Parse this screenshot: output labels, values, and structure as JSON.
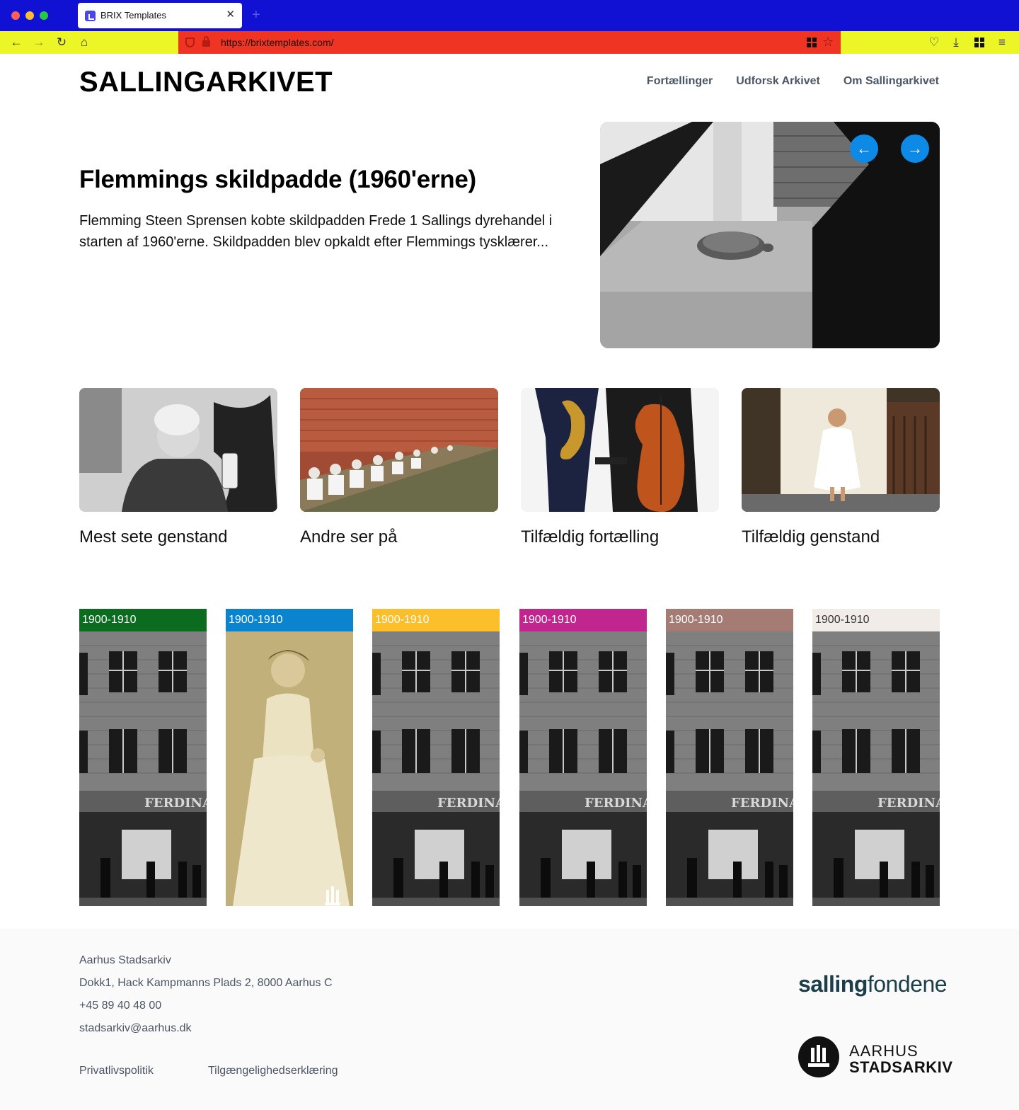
{
  "browser": {
    "tab_title": "BRIX Templates",
    "url": "https://brixtemplates.com/"
  },
  "site": {
    "logo": "SALLINGARKIVET",
    "nav": [
      "Fortællinger",
      "Udforsk Arkivet",
      "Om Sallingarkivet"
    ]
  },
  "hero": {
    "title": "Flemmings skildpadde (1960'erne)",
    "text": "Flemming Steen Sprensen kobte skildpadden Frede 1 Sallings dyrehandel i starten af 1960'erne. Skildpadden blev opkaldt efter Flemmings tysklærer..."
  },
  "cards": [
    {
      "title": "Mest sete genstand"
    },
    {
      "title": "Andre ser på"
    },
    {
      "title": "Tilfældig fortælling"
    },
    {
      "title": "Tilfældig genstand"
    }
  ],
  "decades": [
    {
      "label": "1900-1910",
      "color": "#0b6b1f",
      "text_color": "#ffffff"
    },
    {
      "label": "1900-1910",
      "color": "#0b84d0",
      "text_color": "#ffffff"
    },
    {
      "label": "1900-1910",
      "color": "#fbbf2c",
      "text_color": "#ffffff"
    },
    {
      "label": "1900-1910",
      "color": "#c0268d",
      "text_color": "#ffffff"
    },
    {
      "label": "1900-1910",
      "color": "#a47c74",
      "text_color": "#ffffff"
    },
    {
      "label": "1900-1910",
      "color": "#f2ece9",
      "text_color": "#333333"
    }
  ],
  "footer": {
    "name": "Aarhus Stadsarkiv",
    "address": "Dokk1, Hack Kampmanns Plads 2, 8000 Aarhus C",
    "phone": "+45 89 40 48 00",
    "email": "stadsarkiv@aarhus.dk",
    "links": [
      "Privatlivspolitik",
      "Tilgængelighedserklæring"
    ],
    "salling_logo_bold": "salling",
    "salling_logo_light": "fondene",
    "aarhus_logo_line1": "AARHUS",
    "aarhus_logo_line2": "STADSARKIV"
  }
}
